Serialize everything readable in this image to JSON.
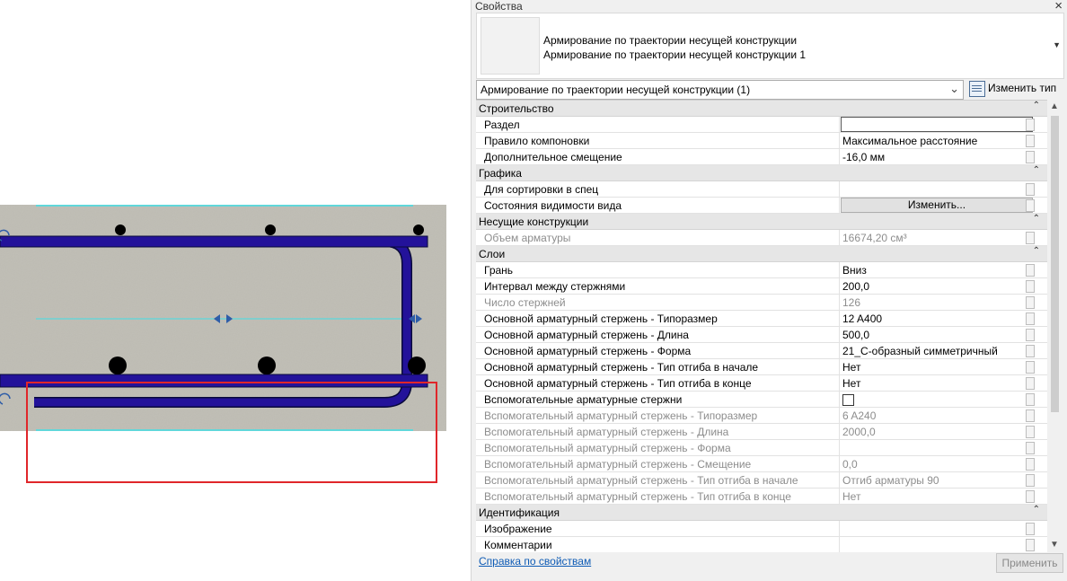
{
  "palette": {
    "title": "Свойства",
    "close_icon": "close-icon",
    "type_selector": {
      "family": "Армирование по траектории несущей конструкции",
      "type_name": "Армирование по траектории несущей конструкции 1"
    },
    "instance_filter": "Армирование по траектории несущей конструкции (1)",
    "edit_type_label": "Изменить тип",
    "help_link": "Справка по свойствам",
    "apply_label": "Применить"
  },
  "groups": [
    {
      "title": "Строительство",
      "rows": [
        {
          "name": "Раздел",
          "value": "",
          "kind": "textbox"
        },
        {
          "name": "Правило компоновки",
          "value": "Максимальное расстояние"
        },
        {
          "name": "Дополнительное смещение",
          "value": "-16,0 мм"
        }
      ]
    },
    {
      "title": "Графика",
      "rows": [
        {
          "name": "Для сортировки в спец",
          "value": ""
        },
        {
          "name": "Состояния видимости вида",
          "value": "Изменить...",
          "kind": "button"
        }
      ]
    },
    {
      "title": "Несущие конструкции",
      "rows": [
        {
          "name": "Объем арматуры",
          "value": "16674,20 см³",
          "readonly": true
        }
      ]
    },
    {
      "title": "Слои",
      "rows": [
        {
          "name": "Грань",
          "value": "Вниз"
        },
        {
          "name": "Интервал между стержнями",
          "value": "200,0"
        },
        {
          "name": "Число стержней",
          "value": "126",
          "readonly": true
        },
        {
          "name": "Основной арматурный стержень - Типоразмер",
          "value": "12 A400"
        },
        {
          "name": "Основной арматурный стержень - Длина",
          "value": "500,0"
        },
        {
          "name": "Основной арматурный стержень - Форма",
          "value": "21_С-образный симметричный"
        },
        {
          "name": "Основной арматурный стержень - Тип отгиба в начале",
          "value": "Нет"
        },
        {
          "name": "Основной арматурный стержень - Тип отгиба в конце",
          "value": "Нет"
        },
        {
          "name": "Вспомогательные арматурные стержни",
          "value": "",
          "kind": "checkbox"
        },
        {
          "name": "Вспомогательный арматурный стержень - Типоразмер",
          "value": "6 A240",
          "readonly": true
        },
        {
          "name": "Вспомогательный арматурный стержень - Длина",
          "value": "2000,0",
          "readonly": true
        },
        {
          "name": "Вспомогательный арматурный стержень - Форма",
          "value": "",
          "readonly": true
        },
        {
          "name": "Вспомогательный арматурный стержень - Смещение",
          "value": "0,0",
          "readonly": true
        },
        {
          "name": "Вспомогательный арматурный стержень - Тип отгиба в начале",
          "value": "Отгиб арматуры 90",
          "readonly": true
        },
        {
          "name": "Вспомогательный арматурный стержень - Тип отгиба в конце",
          "value": "Нет",
          "readonly": true
        }
      ]
    },
    {
      "title": "Идентификация",
      "rows": [
        {
          "name": "Изображение",
          "value": ""
        },
        {
          "name": "Комментарии",
          "value": ""
        }
      ]
    }
  ],
  "colors": {
    "rebar": "#23129a",
    "concrete": "#b9b7ad",
    "selection": "#e0262a",
    "reference_line": "#41e0e6"
  }
}
